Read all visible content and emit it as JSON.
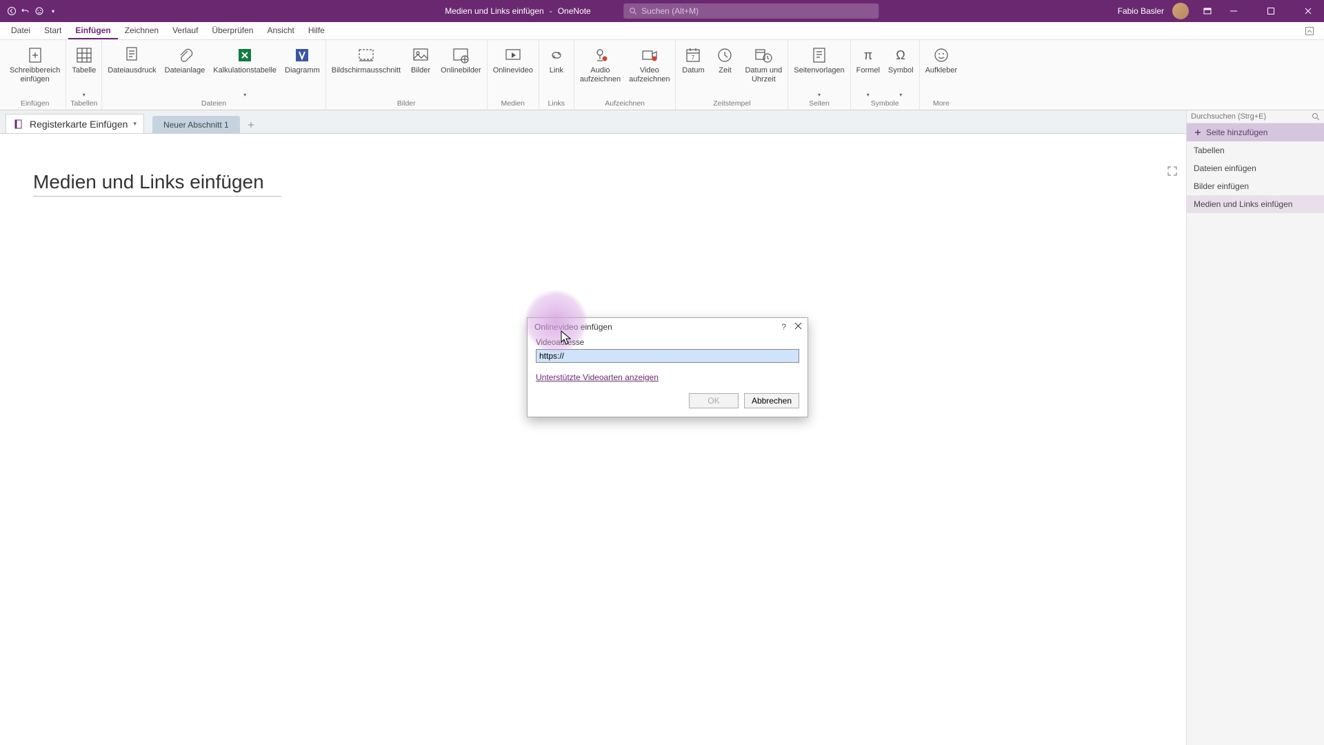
{
  "titlebar": {
    "doc_title": "Medien und Links einfügen",
    "app_name": "OneNote",
    "separator": "-",
    "search_placeholder": "Suchen (Alt+M)",
    "user_name": "Fabio Basler"
  },
  "menu": {
    "items": [
      "Datei",
      "Start",
      "Einfügen",
      "Zeichnen",
      "Verlauf",
      "Überprüfen",
      "Ansicht",
      "Hilfe"
    ],
    "active_index": 2
  },
  "ribbon": {
    "groups": [
      {
        "label": "Einfügen",
        "buttons": [
          {
            "label": "Schreibbereich\neinfügen",
            "icon": "insert-space"
          }
        ]
      },
      {
        "label": "Tabellen",
        "buttons": [
          {
            "label": "Tabelle",
            "icon": "table",
            "dropdown": true
          }
        ]
      },
      {
        "label": "Dateien",
        "buttons": [
          {
            "label": "Dateiausdruck",
            "icon": "file-printout"
          },
          {
            "label": "Dateianlage",
            "icon": "attachment"
          },
          {
            "label": "Kalkulationstabelle",
            "icon": "spreadsheet",
            "dropdown": true
          },
          {
            "label": "Diagramm",
            "icon": "visio"
          }
        ]
      },
      {
        "label": "Bilder",
        "buttons": [
          {
            "label": "Bildschirmausschnitt",
            "icon": "screenclip"
          },
          {
            "label": "Bilder",
            "icon": "picture"
          },
          {
            "label": "Onlinebilder",
            "icon": "online-picture"
          }
        ]
      },
      {
        "label": "Medien",
        "buttons": [
          {
            "label": "Onlinevideo",
            "icon": "online-video"
          }
        ]
      },
      {
        "label": "Links",
        "buttons": [
          {
            "label": "Link",
            "icon": "link"
          }
        ]
      },
      {
        "label": "Aufzeichnen",
        "buttons": [
          {
            "label": "Audio\naufzeichnen",
            "icon": "audio"
          },
          {
            "label": "Video\naufzeichnen",
            "icon": "video-rec"
          }
        ]
      },
      {
        "label": "Zeitstempel",
        "buttons": [
          {
            "label": "Datum",
            "icon": "date"
          },
          {
            "label": "Zeit",
            "icon": "time"
          },
          {
            "label": "Datum und\nUhrzeit",
            "icon": "datetime"
          }
        ]
      },
      {
        "label": "Seiten",
        "buttons": [
          {
            "label": "Seitenvorlagen",
            "icon": "template",
            "dropdown": true
          }
        ]
      },
      {
        "label": "Symbole",
        "buttons": [
          {
            "label": "Formel",
            "icon": "equation",
            "dropdown": true
          },
          {
            "label": "Symbol",
            "icon": "symbol",
            "dropdown": true
          }
        ]
      },
      {
        "label": "More",
        "buttons": [
          {
            "label": "Aufkleber",
            "icon": "sticker"
          }
        ]
      }
    ]
  },
  "notebook": {
    "name": "Registerkarte Einfügen",
    "section": "Neuer Abschnitt 1"
  },
  "page": {
    "title": "Medien und Links einfügen"
  },
  "page_panel": {
    "search_placeholder": "Durchsuchen (Strg+E)",
    "add_page": "Seite hinzufügen",
    "pages": [
      "Tabellen",
      "Dateien einfügen",
      "Bilder einfügen",
      "Medien und Links einfügen"
    ],
    "active_index": 3
  },
  "dialog": {
    "title": "Onlinevideo einfügen",
    "field_label": "Videoadresse",
    "field_value": "https://",
    "link": "Unterstützte Videoarten anzeigen",
    "ok": "OK",
    "cancel": "Abbrechen"
  }
}
